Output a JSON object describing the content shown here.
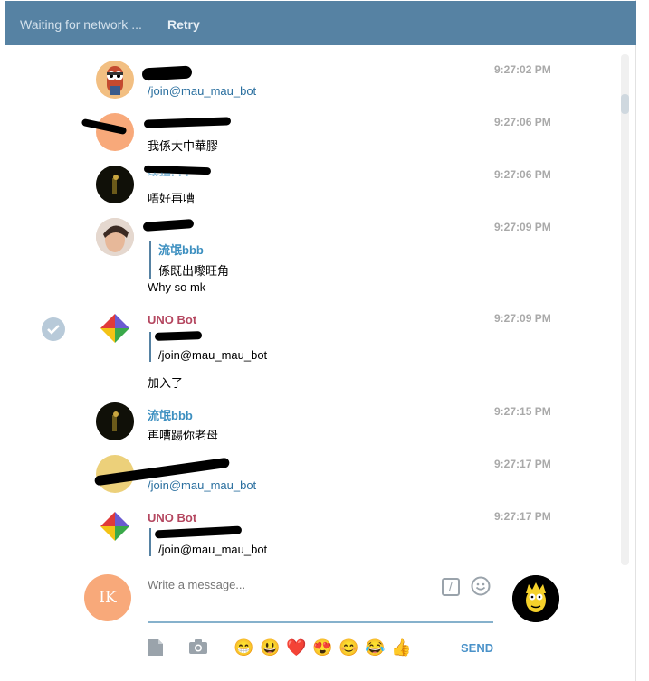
{
  "topbar": {
    "status": "Waiting for network ...",
    "retry": "Retry"
  },
  "messages": [
    {
      "name": "",
      "text": "/join@mau_mau_bot",
      "time": "9:27:02 PM"
    },
    {
      "name": "",
      "text": "我係大中華膠",
      "time": "9:27:06 PM"
    },
    {
      "name": "流氓bbb",
      "text": "唔好再嘈",
      "time": "9:27:06 PM"
    },
    {
      "name": "",
      "reply_name": "流氓bbb",
      "reply_text": "係既出嚟旺角",
      "text": "Why so mk",
      "time": "9:27:09 PM"
    },
    {
      "name": "UNO Bot",
      "reply_text": "/join@mau_mau_bot",
      "text": "加入了",
      "time": "9:27:09 PM"
    },
    {
      "name": "流氓bbb",
      "text": "再嘈踢你老母",
      "time": "9:27:15 PM"
    },
    {
      "name": "",
      "text": "/join@mau_mau_bot",
      "time": "9:27:17 PM"
    },
    {
      "name": "UNO Bot",
      "reply_text": "/join@mau_mau_bot",
      "time": "9:27:17 PM"
    }
  ],
  "composer": {
    "avatar_initials": "IK",
    "placeholder": "Write a message...",
    "command_icon": "/",
    "send": "SEND",
    "emojis": [
      "😁",
      "😃",
      "❤️",
      "😍",
      "😊",
      "😂",
      "👍"
    ]
  },
  "colors": {
    "topbar": "#5682a3",
    "name_blue": "#3c8fc0",
    "name_pink": "#b4465f",
    "send": "#4a92c9"
  }
}
